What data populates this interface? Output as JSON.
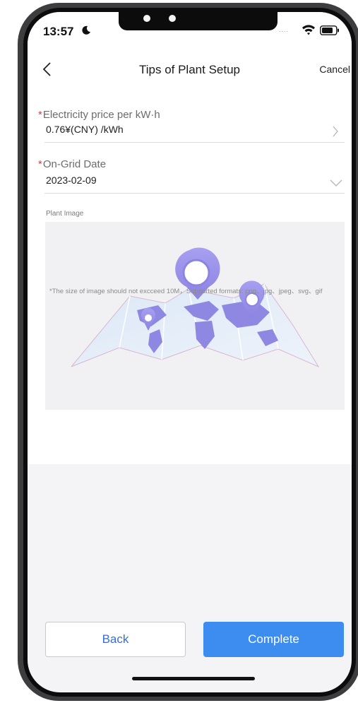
{
  "status_bar": {
    "time": "13:57",
    "signal": "....",
    "icons": [
      "moon-icon",
      "wifi-icon",
      "battery-icon"
    ]
  },
  "nav": {
    "back_icon": "chevron-left-icon",
    "title": "Tips of Plant Setup",
    "cancel_label": "Cancel"
  },
  "form": {
    "required_mark": "*",
    "price": {
      "label": "Electricity price per kW·h",
      "value": "0.76¥(CNY) /kWh",
      "icon": "chevron-right-icon"
    },
    "date": {
      "label": "On-Grid Date",
      "value": "2023-02-09",
      "icon": "chevron-down-icon"
    },
    "image": {
      "label": "Plant Image",
      "placeholder_icon": "map-pin-illustration",
      "hint": "*The size of image should not excceed 10M，Supported formats: png、jpg、jpeg、svg、gif"
    }
  },
  "actions": {
    "back_label": "Back",
    "complete_label": "Complete"
  },
  "colors": {
    "primary": "#3d8cf0",
    "required": "#e5383b",
    "pin": "#9c94ea"
  }
}
